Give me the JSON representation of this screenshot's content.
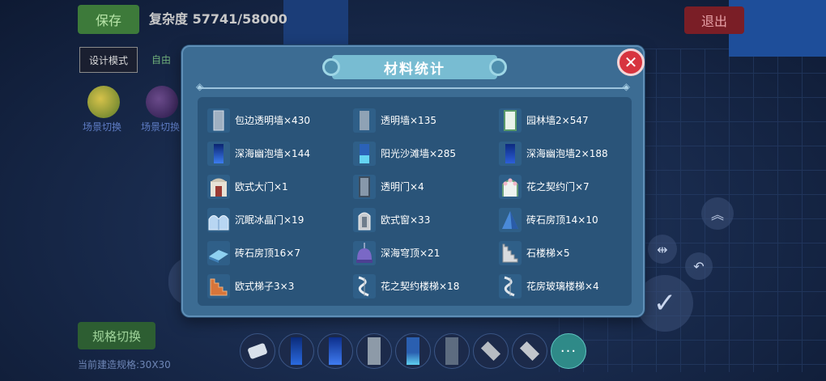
{
  "background": {
    "save_label": "保存",
    "complexity_text": "复杂度 57741/58000",
    "exit_label": "退出",
    "mode_design": "设计模式",
    "mode_free": "自由",
    "scene_caption_1": "场景切换",
    "scene_caption_2": "场景切换",
    "spec_switch_label": "规格切换",
    "current_area_text": "当前建造规格:30X30"
  },
  "dialog": {
    "title": "材料统计",
    "close_label": "✕",
    "items": [
      {
        "label": "包边透明墙×430",
        "icon": "clear-wall-icon"
      },
      {
        "label": "透明墙×135",
        "icon": "clear-wall-icon"
      },
      {
        "label": "园林墙2×547",
        "icon": "garden-wall-icon"
      },
      {
        "label": "深海幽泡墙×144",
        "icon": "deep-sea-wall-icon"
      },
      {
        "label": "阳光沙滩墙×285",
        "icon": "beach-wall-icon"
      },
      {
        "label": "深海幽泡墙2×188",
        "icon": "deep-sea-wall-icon"
      },
      {
        "label": "欧式大门×1",
        "icon": "euro-gate-icon"
      },
      {
        "label": "透明门×4",
        "icon": "clear-door-icon"
      },
      {
        "label": "花之契约门×7",
        "icon": "flower-door-icon"
      },
      {
        "label": "沉眠冰晶门×19",
        "icon": "ice-door-icon"
      },
      {
        "label": "欧式窗×33",
        "icon": "euro-window-icon"
      },
      {
        "label": "砖石房顶14×10",
        "icon": "roof-icon"
      },
      {
        "label": "砖石房顶16×7",
        "icon": "flat-roof-icon"
      },
      {
        "label": "深海穹顶×21",
        "icon": "dome-icon"
      },
      {
        "label": "石楼梯×5",
        "icon": "stone-stairs-icon"
      },
      {
        "label": "欧式梯子3×3",
        "icon": "ladder-icon"
      },
      {
        "label": "花之契约楼梯×18",
        "icon": "spiral-stairs-icon"
      },
      {
        "label": "花房玻璃楼梯×4",
        "icon": "spiral-stairs-icon"
      }
    ]
  },
  "hotbar": {
    "more_label": "···"
  },
  "colors": {
    "dialog_bg": "#3c6c93",
    "panel_bg": "#2a5479",
    "title_banner": "#78bcd2",
    "close_red": "#d7343f"
  }
}
